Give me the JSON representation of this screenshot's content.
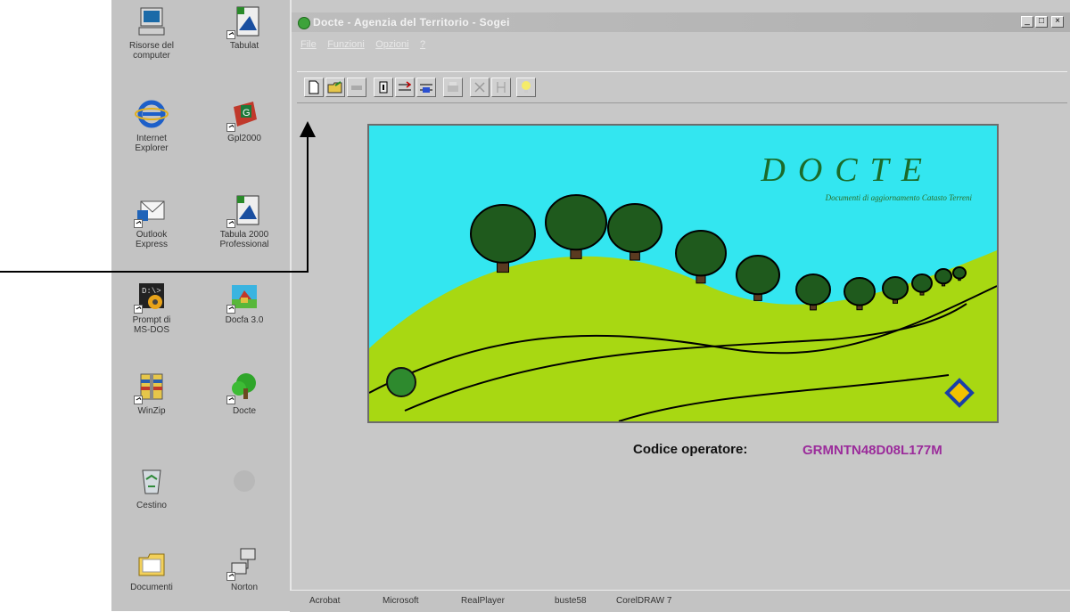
{
  "desktop": {
    "icons": [
      {
        "label": "Risorse del\ncomputer",
        "icon": "my-computer-icon"
      },
      {
        "label": "Tabulat",
        "icon": "tabulat-icon"
      },
      {
        "label": "Internet\nExplorer",
        "icon": "internet-explorer-icon"
      },
      {
        "label": "Gpl2000",
        "icon": "gpl2000-icon"
      },
      {
        "label": "Outlook\nExpress",
        "icon": "outlook-express-icon"
      },
      {
        "label": "Tabula 2000\nProfessional",
        "icon": "tabula-2000-icon"
      },
      {
        "label": "Prompt di\nMS-DOS",
        "icon": "ms-dos-prompt-icon"
      },
      {
        "label": "Docfa 3.0",
        "icon": "docfa-icon"
      },
      {
        "label": "WinZip",
        "icon": "winzip-icon"
      },
      {
        "label": "Docte",
        "icon": "docte-icon"
      },
      {
        "label": "Cestino",
        "icon": "recycle-bin-icon"
      },
      {
        "label": "Documenti",
        "icon": "documents-folder-icon"
      },
      {
        "label": "Norton",
        "icon": "norton-icon"
      }
    ]
  },
  "window": {
    "title": "Docte - Agenzia del Territorio - Sogei",
    "menu": [
      "File",
      "Funzioni",
      "Opzioni",
      "?"
    ],
    "toolbar_icons": [
      "new-document-icon",
      "open-folder-icon",
      "disabled-tool-icon",
      "delete-icon",
      "import-icon",
      "export-icon",
      "print-icon",
      "cut-icon",
      "merge-icon",
      "lightbulb-icon"
    ]
  },
  "splash": {
    "brand": "DOCTE",
    "subtitle": "Documenti di aggiornamento Catasto Terreni",
    "colors": {
      "sky": "#33e6f0",
      "hill": "#a8d812",
      "tree": "#1f5a1d",
      "trunk": "#5a3a20"
    }
  },
  "operator": {
    "label": "Codice operatore:",
    "code": "GRMNTN48D08L177M"
  },
  "taskbar": {
    "items": [
      "Acrobat",
      "Microsoft",
      "RealPlayer",
      "buste58",
      "CorelDRAW 7"
    ]
  }
}
